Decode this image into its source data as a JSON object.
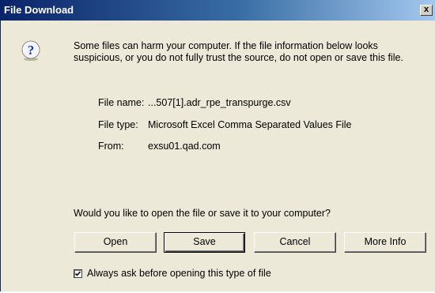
{
  "window": {
    "title": "File Download",
    "close_label": "x"
  },
  "message": {
    "warning": "Some files can harm your computer. If the file information below looks suspicious, or you do not fully trust the source, do not open or save this file.",
    "icon": "question-icon"
  },
  "file_info": {
    "name_label": "File name:",
    "name_value": "...507[1].adr_rpe_transpurge.csv",
    "type_label": "File type:",
    "type_value": "Microsoft Excel Comma Separated Values File",
    "from_label": "From:",
    "from_value": "exsu01.qad.com"
  },
  "prompt": {
    "question": "Would you like to open the file or save it to your computer?"
  },
  "buttons": {
    "open": "Open",
    "save": "Save",
    "cancel": "Cancel",
    "more_info": "More Info"
  },
  "checkbox": {
    "label": "Always ask before opening this type of file",
    "checked": true
  },
  "colors": {
    "titlebar_start": "#0a246a",
    "titlebar_end": "#a6caf0",
    "dialog_bg": "#ece9d8",
    "icon_blue": "#1a3ca8"
  }
}
